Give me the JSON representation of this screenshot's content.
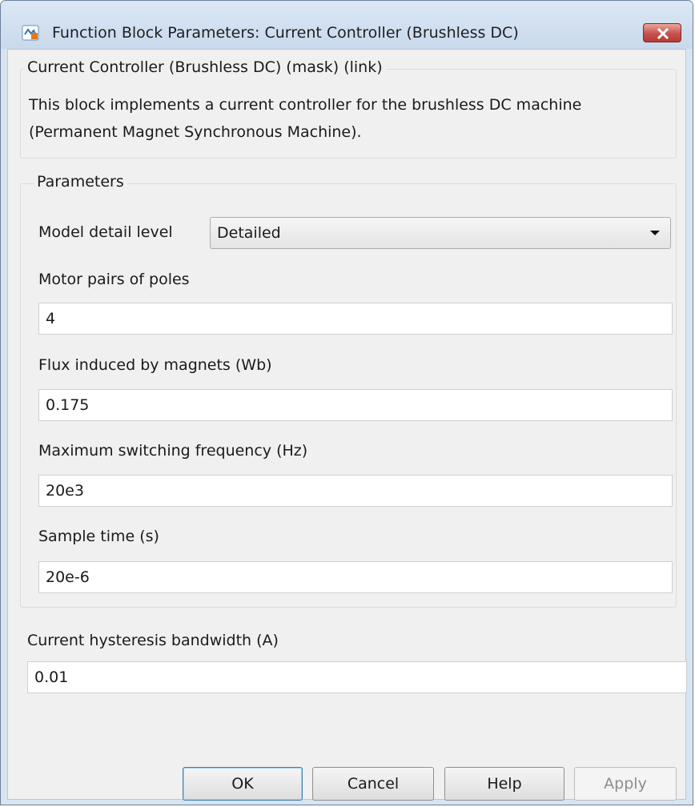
{
  "window": {
    "title": "Function Block Parameters: Current Controller (Brushless DC)",
    "close_icon": "close-icon"
  },
  "description": {
    "legend": "Current Controller (Brushless DC) (mask) (link)",
    "text": "This block implements a current controller for the brushless DC machine (Permanent Magnet Synchronous Machine)."
  },
  "parameters": {
    "legend": "Parameters",
    "model_detail": {
      "label": "Model detail level",
      "value": "Detailed"
    },
    "pole_pairs": {
      "label": "Motor pairs of poles",
      "value": "4"
    },
    "flux": {
      "label": "Flux induced by magnets (Wb)",
      "value": "0.175"
    },
    "max_freq": {
      "label": "Maximum switching frequency (Hz)",
      "value": "20e3"
    },
    "sample_time": {
      "label": "Sample time (s)",
      "value": "20e-6"
    }
  },
  "hysteresis": {
    "label": "Current hysteresis bandwidth (A)",
    "value": "0.01"
  },
  "buttons": {
    "ok": "OK",
    "cancel": "Cancel",
    "help": "Help",
    "apply": "Apply"
  },
  "colors": {
    "window_frame": "#d9e4f1",
    "client_bg": "#f0f0f0",
    "close_button": "#c75050",
    "default_button_border": "#3c7fb1"
  }
}
